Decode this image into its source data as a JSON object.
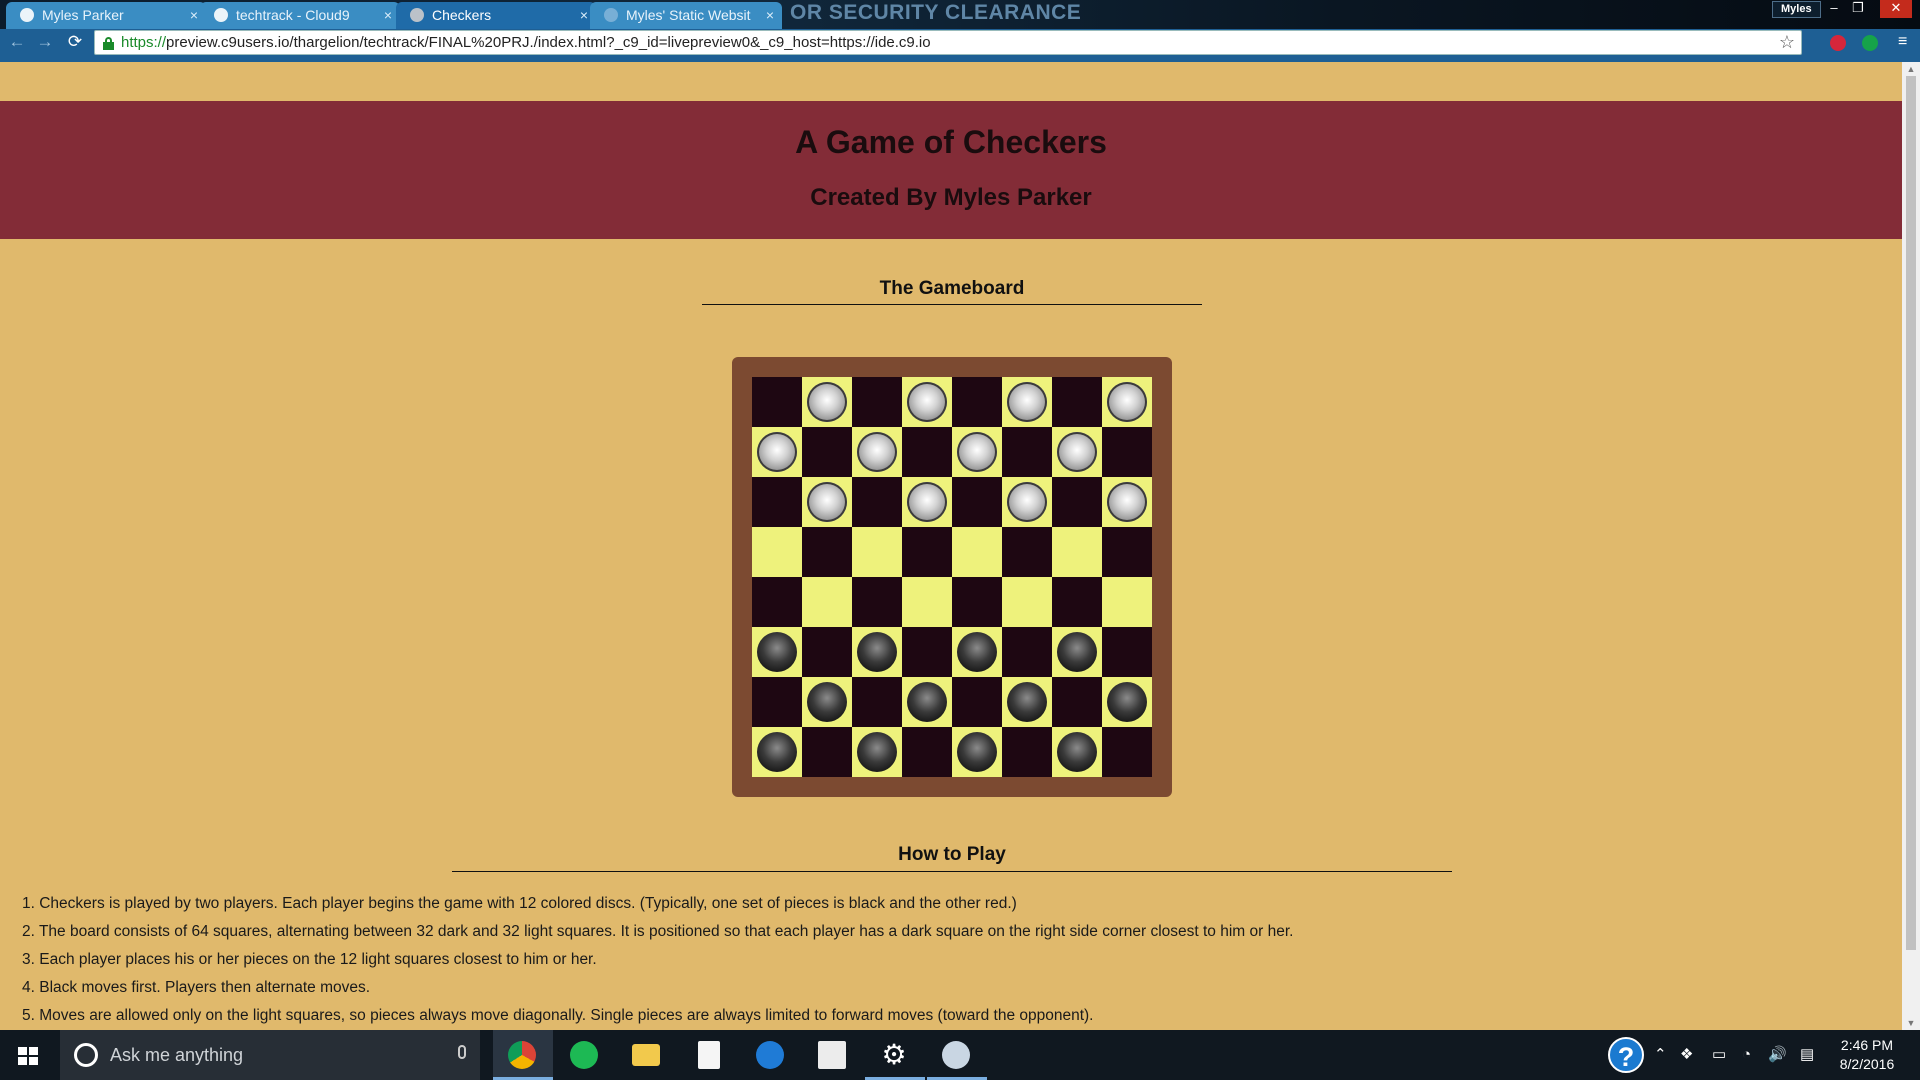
{
  "browser": {
    "tabs": [
      {
        "title": "Myles Parker",
        "active": false
      },
      {
        "title": "techtrack - Cloud9",
        "active": false
      },
      {
        "title": "Checkers",
        "active": true
      },
      {
        "title": "Myles' Static Websit",
        "active": false
      }
    ],
    "tab_close_glyph": "×",
    "background_banner": "OR SECURITY CLEARANCE",
    "profile_name": "Myles",
    "window_controls": {
      "minimize": "–",
      "restore": "❐",
      "close": "✕"
    },
    "nav": {
      "back": "←",
      "forward": "→",
      "reload": "⟳"
    },
    "url_scheme": "https://",
    "url_rest": "preview.c9users.io/thargelion/techtrack/FINAL%20PRJ./index.html?_c9_id=livepreview0&_c9_host=https://ide.c9.io",
    "star_glyph": "☆",
    "menu_glyph": "≡",
    "icons": [
      "back-icon",
      "forward-icon",
      "reload-icon",
      "lock-icon",
      "star-icon",
      "extension-icon",
      "menu-icon"
    ]
  },
  "page": {
    "title": "A Game of Checkers",
    "subtitle": "Created By Myles Parker",
    "gameboard_heading": "The Gameboard",
    "how_to_play_heading": "How to Play",
    "rules": [
      "1.  Checkers is played by two players. Each player begins the game with 12 colored discs. (Typically, one set of pieces is black and the other red.)",
      "2.  The board consists of 64 squares, alternating between 32 dark and 32 light squares. It is positioned so that each player has a dark square on the right side corner closest to him or her.",
      "3.  Each player places his or her pieces on the 12 light squares closest to him or her.",
      "4.  Black moves first. Players then alternate moves.",
      "5.  Moves are allowed only on the light squares, so pieces always move diagonally. Single pieces are always limited to forward moves (toward the opponent)."
    ],
    "colors": {
      "page_bg": "#e0b96c",
      "header_bg": "#832c37",
      "board_frame": "#7c4a31",
      "dark_square": "#1e0712",
      "light_square": "#eef27c"
    }
  },
  "board": {
    "rows": [
      "-w-w-w-w",
      "w-w-w-w-",
      "-w-w-w-w",
      "--------",
      "--------",
      "b-b-b-b-",
      "-b-b-b-b",
      "b-b-b-b-"
    ],
    "top_left_square": "dark"
  },
  "taskbar": {
    "search_placeholder": "Ask me anything",
    "time": "2:46 PM",
    "date": "8/2/2016",
    "help_glyph": "?",
    "tray_glyphs": [
      "⌃",
      "❖",
      "▭",
      "◔",
      "🔊",
      "▤"
    ],
    "apps": [
      "chrome-icon",
      "spotify-icon",
      "file-explorer-icon",
      "document-icon",
      "edge-icon",
      "store-icon",
      "settings-icon",
      "paint-icon"
    ]
  }
}
